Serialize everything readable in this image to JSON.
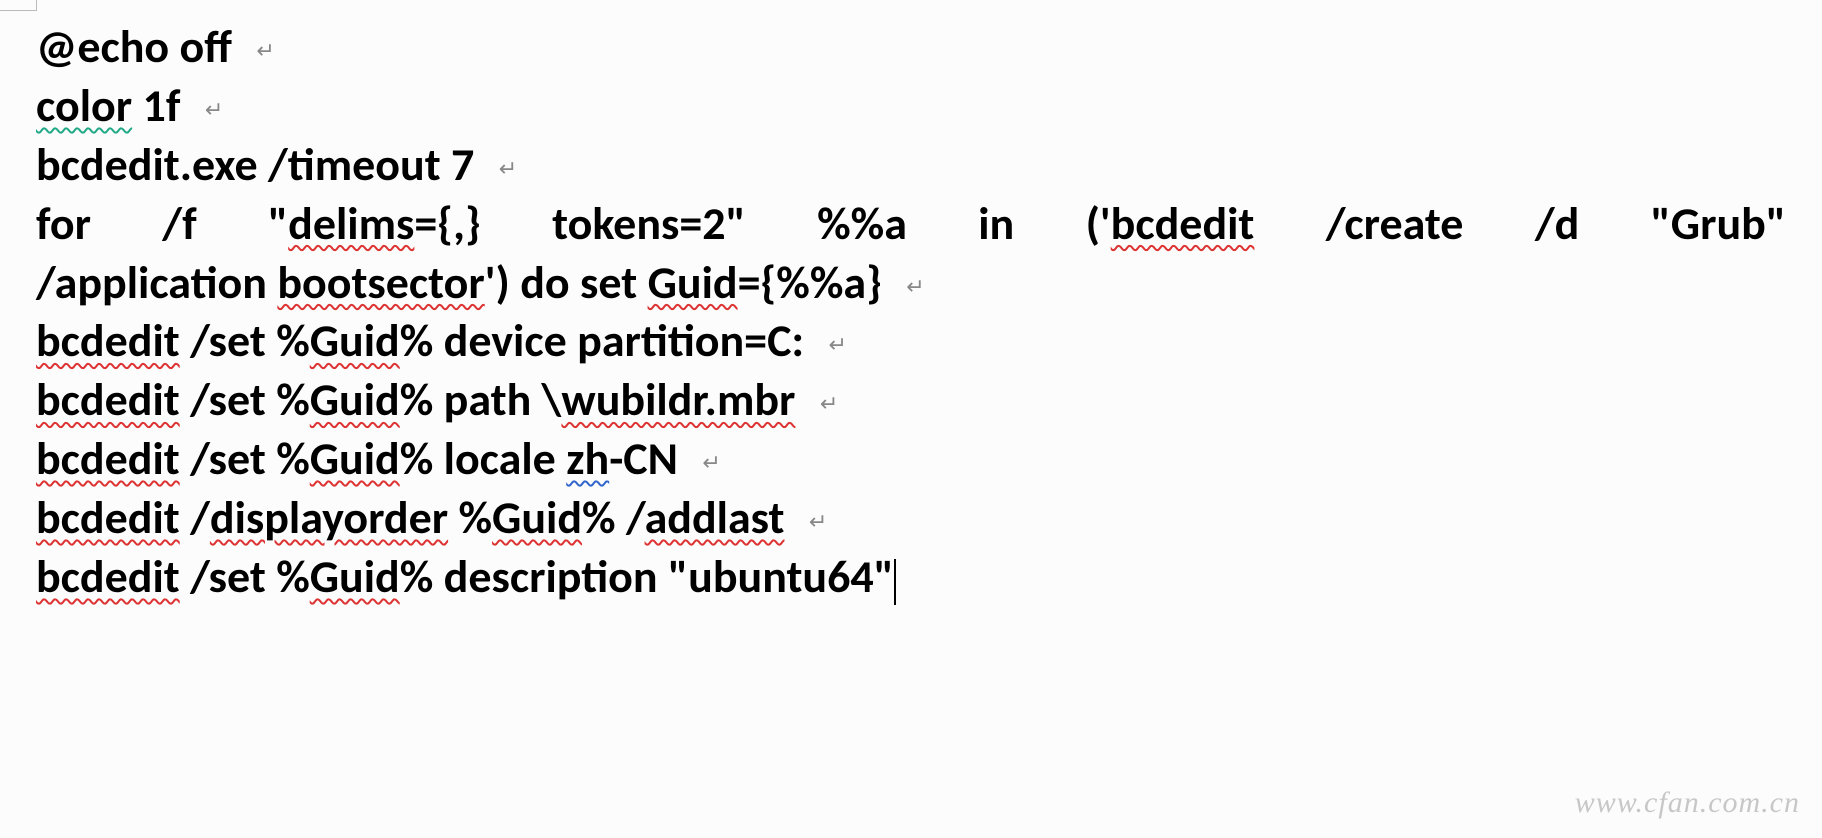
{
  "lines": {
    "l1a": "@echo off",
    "l2a": "color",
    "l2b": " 1f",
    "l3a": "bcdedit.exe /timeout 7",
    "l4a": "for /f \"",
    "l4b": "delims",
    "l4c": "={,} tokens=2\" %%a in ('",
    "l4d": "bcdedit",
    "l4e": " /create /d \"Grub\" ",
    "l5a": "/application ",
    "l5b": "bootsector",
    "l5c": "') do set ",
    "l5d": "Guid",
    "l5e": "={%%a}",
    "l6a": "bcdedit",
    "l6b": " /set %",
    "l6c": "Guid",
    "l6d": "% device partition=C:",
    "l7a": "bcdedit",
    "l7b": " /set %",
    "l7c": "Guid",
    "l7d": "% path \\",
    "l7e": "wubildr.mbr",
    "l8a": "bcdedit",
    "l8b": " /set %",
    "l8c": "Guid",
    "l8d": "% locale ",
    "l8e": "zh",
    "l8f": "-CN",
    "l9a": "bcdedit",
    "l9b": " /",
    "l9c": "displayorder",
    "l9d": " %",
    "l9e": "Guid",
    "l9f": "% /",
    "l9g": "addlast",
    "l10a": "bcdedit",
    "l10b": " /set  %",
    "l10c": "Guid",
    "l10d": "% description \"ubuntu64\""
  },
  "pilcrow": "↵",
  "watermark": "www.cfan.com.cn"
}
